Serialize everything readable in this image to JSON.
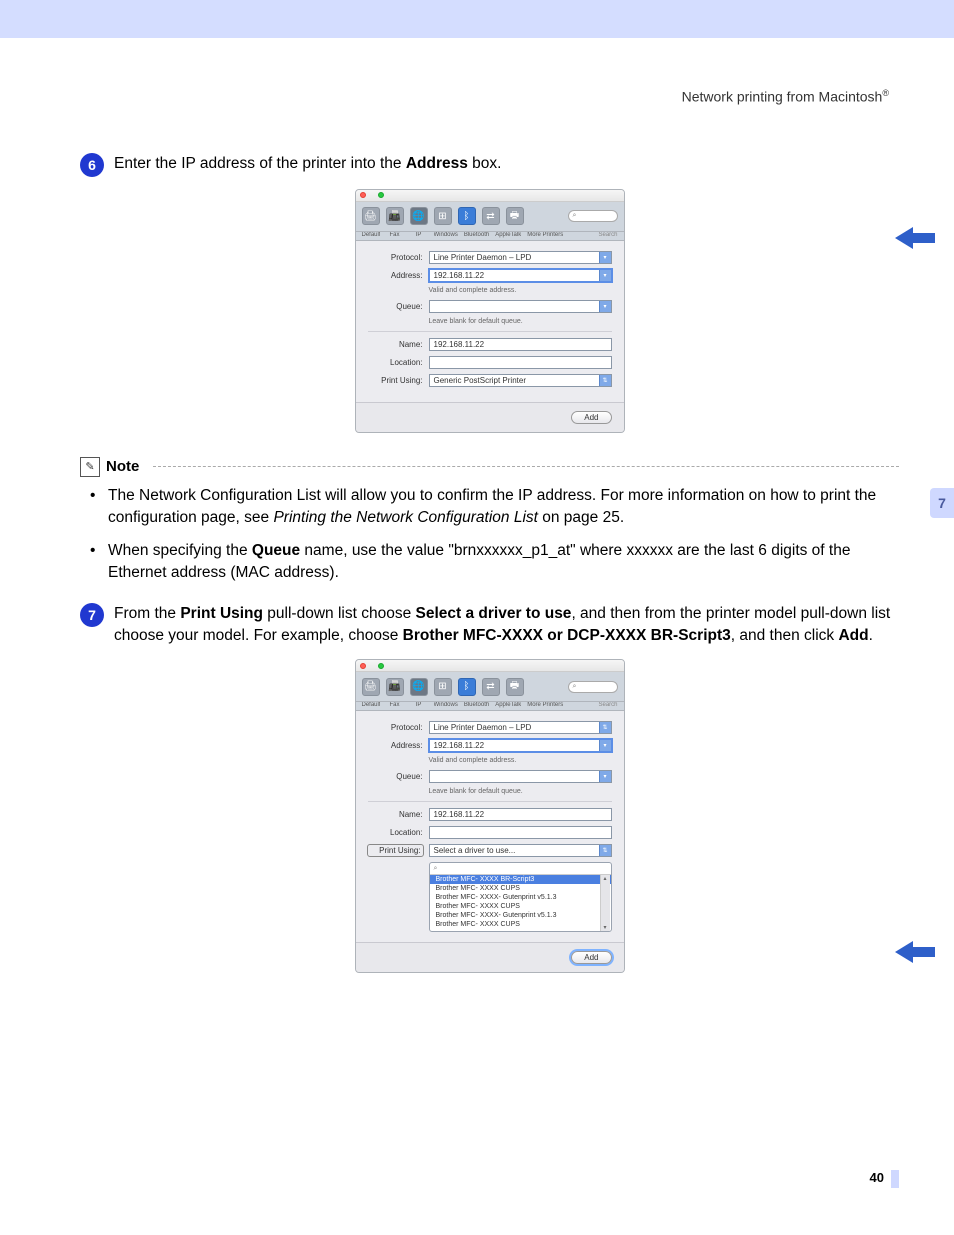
{
  "header": {
    "title": "Network printing from Macintosh",
    "registered": "®"
  },
  "steps": {
    "s6": {
      "num": "6",
      "t1": "Enter the IP address of the printer into the ",
      "b1": "Address",
      "t2": " box."
    },
    "s7": {
      "num": "7",
      "t1": "From the ",
      "b1": "Print Using",
      "t2": " pull-down list choose ",
      "b2": "Select a driver to use",
      "t3": ", and then from the printer model pull-down list choose your model. For example, choose ",
      "b3": "Brother MFC-XXXX or DCP-XXXX BR-Script3",
      "t4": ", and then click ",
      "b4": "Add",
      "t5": "."
    }
  },
  "note": {
    "title": "Note",
    "bullets": {
      "b1": {
        "t1": "The Network Configuration List will allow you to confirm the IP address. For more information on how to print the configuration page, see ",
        "i1": "Printing the Network Configuration List",
        "t2": " on page 25."
      },
      "b2": {
        "t1": "When specifying the ",
        "b1": "Queue",
        "t2": " name, use the value \"brnxxxxxx_p1_at\" where xxxxxx are the last 6 digits of the Ethernet address (MAC address)."
      }
    }
  },
  "mac1": {
    "toolbar": {
      "labels": [
        "Default",
        "Fax",
        "IP",
        "Windows",
        "Bluetooth",
        "AppleTalk",
        "More Printers"
      ],
      "search_icon": "⌕",
      "search_lbl": "Search"
    },
    "protocol_lbl": "Protocol:",
    "protocol_val": "Line Printer Daemon – LPD",
    "address_lbl": "Address:",
    "address_val": "192.168.11.22",
    "address_hint": "Valid and complete address.",
    "queue_lbl": "Queue:",
    "queue_hint": "Leave blank for default queue.",
    "name_lbl": "Name:",
    "name_val": "192.168.11.22",
    "location_lbl": "Location:",
    "pu_lbl": "Print Using:",
    "pu_val": "Generic PostScript Printer",
    "add_btn": "Add"
  },
  "mac2": {
    "pu_val": "Select a driver to use...",
    "drivers": [
      "Brother MFC- XXXX BR-Script3",
      "Brother MFC- XXXX CUPS",
      "Brother MFC- XXXX- Gutenprint v5.1.3",
      "Brother MFC- XXXX CUPS",
      "Brother MFC- XXXX- Gutenprint v5.1.3",
      "Brother MFC- XXXX CUPS"
    ]
  },
  "side_tab": "7",
  "page_num": "40"
}
